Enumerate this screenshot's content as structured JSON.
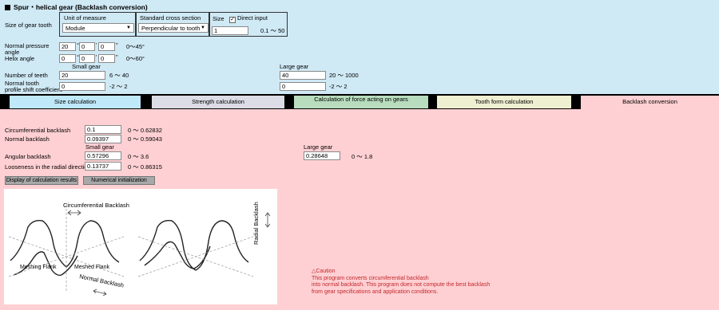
{
  "title": "Spur・helical gear (Backlash conversion)",
  "size_of_gear_tooth_label": "Size of gear tooth",
  "unit_of_measure": {
    "label": "Unit of measure",
    "value": "Module"
  },
  "standard_cross_section": {
    "label": "Standard cross section",
    "value": "Perpendicular to tooth"
  },
  "size": {
    "label": "Size",
    "direct_input_label": "Direct input",
    "value": "1",
    "range": "0.1 ～ 50"
  },
  "normal_pressure_angle": {
    "label_line1": "Normal pressure",
    "label_line2": "angle",
    "deg": "20",
    "min": "0",
    "sec": "0",
    "range": "0～45°"
  },
  "helix_angle": {
    "label": "Helix angle",
    "deg": "0",
    "min": "0",
    "sec": "0",
    "range": "0～60°"
  },
  "unit_deg": "°",
  "unit_min": "'",
  "unit_sec": "\"",
  "small_gear_label": "Small gear",
  "large_gear_label": "Large gear",
  "number_of_teeth": {
    "label": "Number of teeth",
    "small": "20",
    "small_range": "6 ～ 40",
    "large": "40",
    "large_range": "20 ～ 1000"
  },
  "profile_shift": {
    "label_line1": "Normal tooth",
    "label_line2": "profile shift coefficient",
    "small": "0",
    "small_range": "-2 ～ 2",
    "large": "0",
    "large_range": "-2 ～ 2"
  },
  "tabs": [
    {
      "label": "Size calculation",
      "color": "#bfe8f9"
    },
    {
      "label": "Strength calculation",
      "color": "#dcdce6"
    },
    {
      "label": "Calculation of force acting on gears",
      "color": "#b8ddbe"
    },
    {
      "label": "Tooth form calculation",
      "color": "#efefd2"
    },
    {
      "label": "Backlash conversion",
      "color": "#ffd0d3"
    }
  ],
  "circumferential_backlash": {
    "label": "Circumferential backlash",
    "value": "0.1",
    "range": "0 ～ 0.62832"
  },
  "normal_backlash": {
    "label": "Normal backlash",
    "value": "0.09397",
    "range": "0 ～ 0.59043"
  },
  "angular_backlash": {
    "label": "Angular backlash",
    "small": "0.57296",
    "small_range": "0 ～ 3.6",
    "large": "0.28648",
    "large_range": "0 ～ 1.8"
  },
  "radial_looseness": {
    "label": "Looseness in the radial direction",
    "value": "0.13737",
    "range": "0 ～ 0.86315"
  },
  "buttons": {
    "display_results": "Display of calculation results",
    "numerical_init": "Numerical initialization"
  },
  "figure_labels": {
    "circumferential": "Circumferential Backlash",
    "meshing": "Meshing Flank",
    "meshed": "Meshed Flank",
    "normal": "Normal Backlash",
    "radial": "Radial Backlash"
  },
  "caution": {
    "title": "Caution",
    "line1": "This program converts circumferential backlash",
    "line2": "into normal backlash. This program does not compute the best backlash",
    "line3": "from gear specifications and application conditions."
  }
}
